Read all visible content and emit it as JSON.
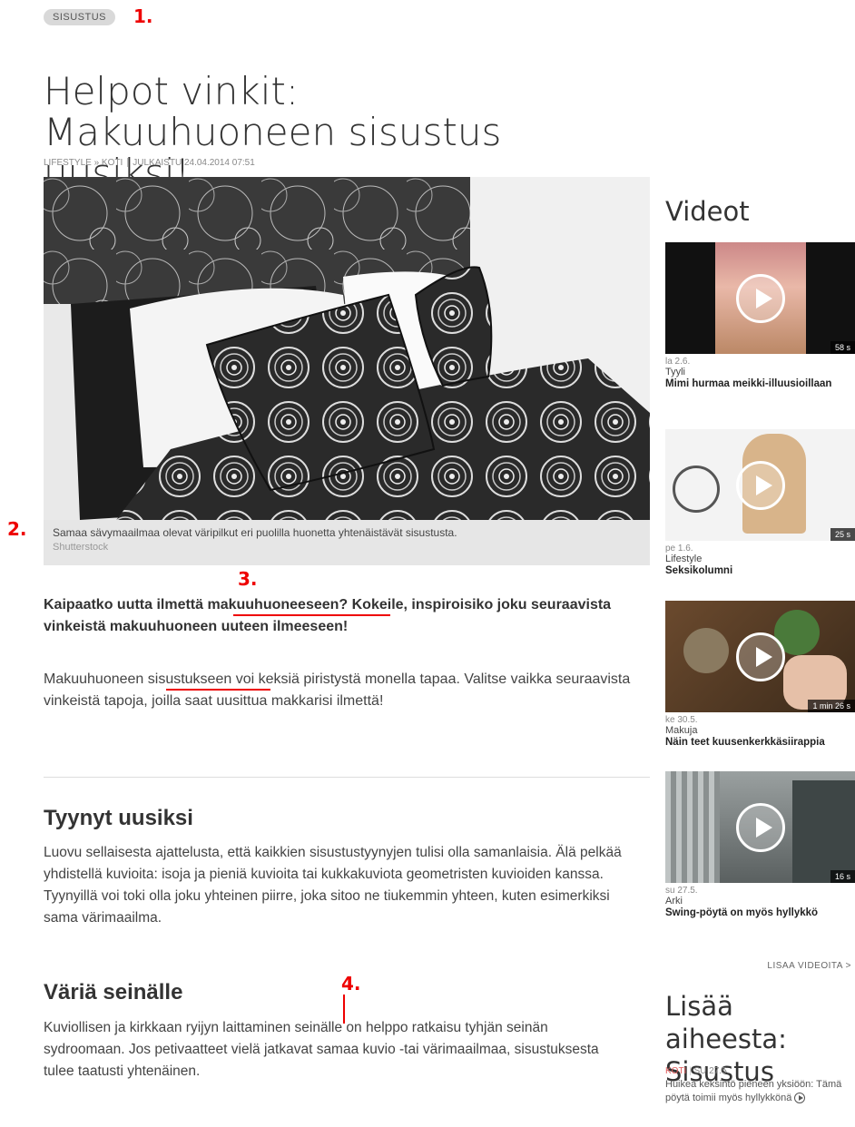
{
  "article": {
    "tag": "SISUSTUS",
    "title": "Helpot vinkit: Makuuhuoneen sisustus uusiksi!",
    "breadcrumb": "LIFESTYLE » KOTI",
    "published": "JULKAISTU 24.04.2014 07:51",
    "image_caption": "Samaa sävymaailmaa olevat väripilkut eri puolilla huonetta yhtenäistävät sisustusta.",
    "image_credit": "Shutterstock",
    "lead": "Kaipaatko uutta ilmettä makuuhuoneeseen? Kokeile, inspiroisiko joku seuraavista vinkeistä makuuhuoneen uuteen ilmeeseen!",
    "intro": "Makuuhuoneen sisustukseen voi keksiä piristystä monella tapaa. Valitse vaikka seuraavista vinkeistä tapoja, joilla saat uusittua makkarisi ilmettä!",
    "section1_title": "Tyynyt uusiksi",
    "section1_text": "Luovu sellaisesta ajattelusta, että kaikkien sisustustyynyjen tulisi olla samanlaisia. Älä pelkää yhdistellä kuvioita: isoja ja pieniä kuvioita tai kukkakuviota geometristen kuvioiden kanssa. Tyynyillä voi toki olla joku yhteinen piirre, joka sitoo ne tiukemmin yhteen, kuten esimerkiksi sama värimaailma.",
    "section2_title": "Väriä seinälle",
    "section2_text": "Kuviollisen ja kirkkaan ryijyn laittaminen seinälle on helppo ratkaisu tyhjän seinän sydroomaan. Jos petivaatteet vielä jatkavat samaa kuvio -tai värimaailmaa, sisustuksesta tulee taatusti yhtenäinen."
  },
  "annotations": {
    "n1": "1.",
    "n2": "2.",
    "n3": "3.",
    "n4": "4."
  },
  "sidebar": {
    "videos_title": "Videot",
    "videos": [
      {
        "date": "la 2.6.",
        "category": "Tyyli",
        "title": "Mimi hurmaa meikki-illuusioillaan",
        "duration": "58 s"
      },
      {
        "date": "pe 1.6.",
        "category": "Lifestyle",
        "title": "Seksikolumni",
        "duration": "25 s"
      },
      {
        "date": "ke 30.5.",
        "category": "Makuja",
        "title": "Näin teet kuusenkerkkäsiirappia",
        "duration": "1 min 26 s"
      },
      {
        "date": "su 27.5.",
        "category": "Arki",
        "title": "Swing-pöytä on myös hyllykkö",
        "duration": "16 s"
      }
    ],
    "more_videos": "LISAA VIDEOITA >",
    "related_title": "Lisää aiheesta: Sisustus",
    "related_category": "KOTI",
    "related_date": "SU 27.5.",
    "related_item": "Huikea keksintö pieneen yksiöön: Tämä pöytä toimii myös hyllykkönä"
  },
  "colors": {
    "annotation_red": "#e00000",
    "caption_bg": "#e6e6e6"
  }
}
